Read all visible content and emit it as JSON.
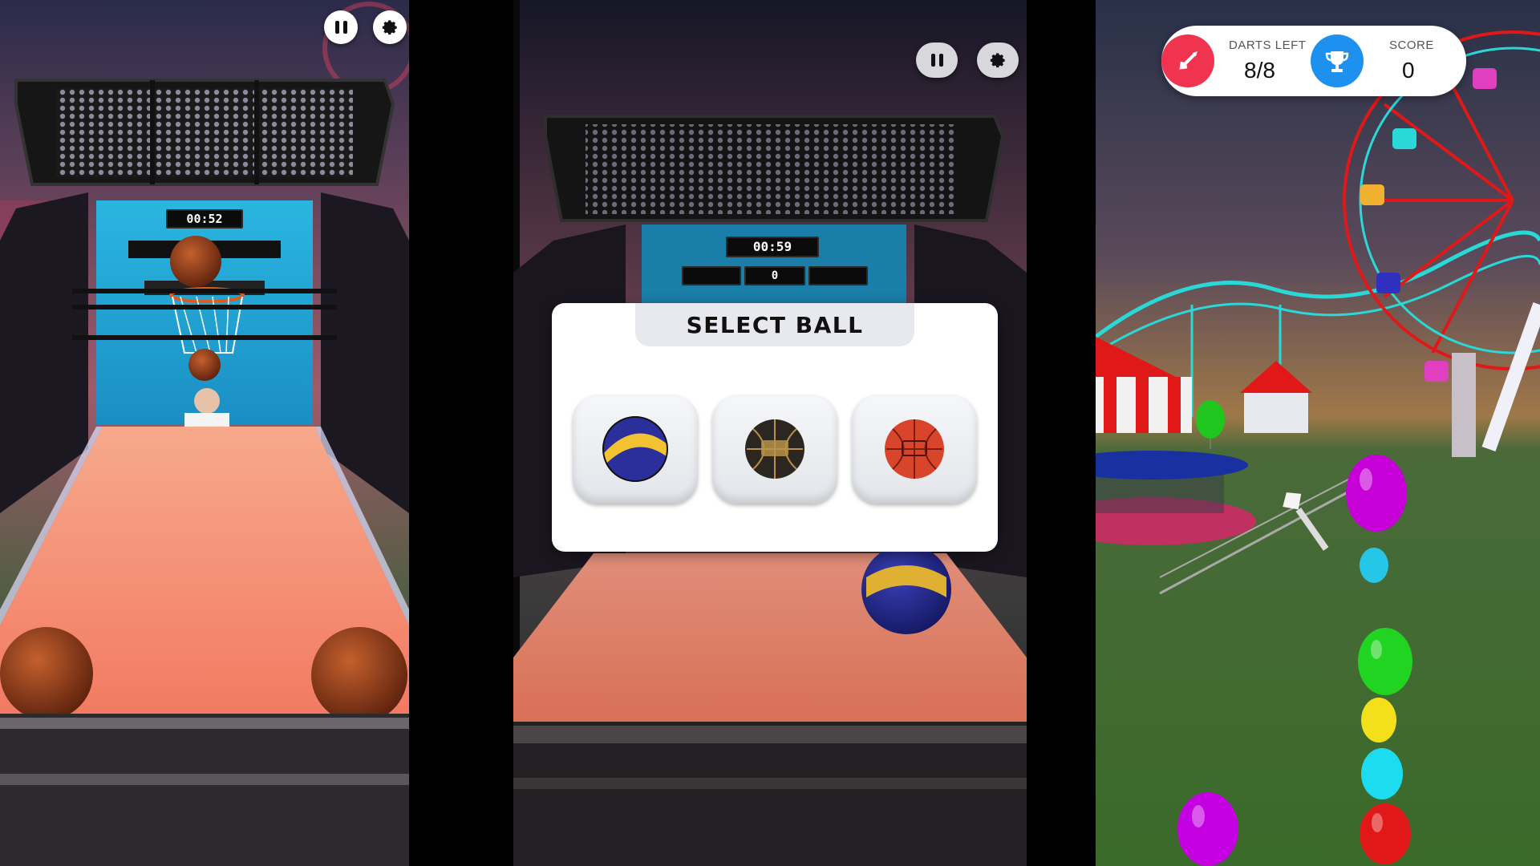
{
  "panel_left": {
    "timer": "00:52",
    "controls": {
      "pause_icon": "pause-icon",
      "settings_icon": "gear-icon"
    }
  },
  "panel_middle": {
    "timer": "00:59",
    "score_display": "0",
    "controls": {
      "pause_icon": "pause-icon",
      "settings_icon": "gear-icon"
    },
    "select_ball": {
      "title": "SELECT BALL",
      "balls": [
        {
          "name": "blue-yellow-ball",
          "colors": [
            "#2a2f9c",
            "#f2c230"
          ]
        },
        {
          "name": "black-gold-ball",
          "colors": [
            "#2b2620",
            "#b8924a"
          ]
        },
        {
          "name": "orange-ball",
          "colors": [
            "#d8452a",
            "#7a1e10"
          ]
        }
      ]
    }
  },
  "panel_right": {
    "hud": {
      "darts_label": "DARTS LEFT",
      "darts_value": "8/8",
      "score_label": "SCORE",
      "score_value": "0",
      "dart_icon_color": "#f0344f",
      "trophy_icon_color": "#1e90f0"
    },
    "balloon_colors": [
      "#1ec61e",
      "#c800d8",
      "#26c6e8",
      "#22d422",
      "#f4e01a",
      "#1edcf0",
      "#e01818",
      "#c400e0"
    ]
  }
}
